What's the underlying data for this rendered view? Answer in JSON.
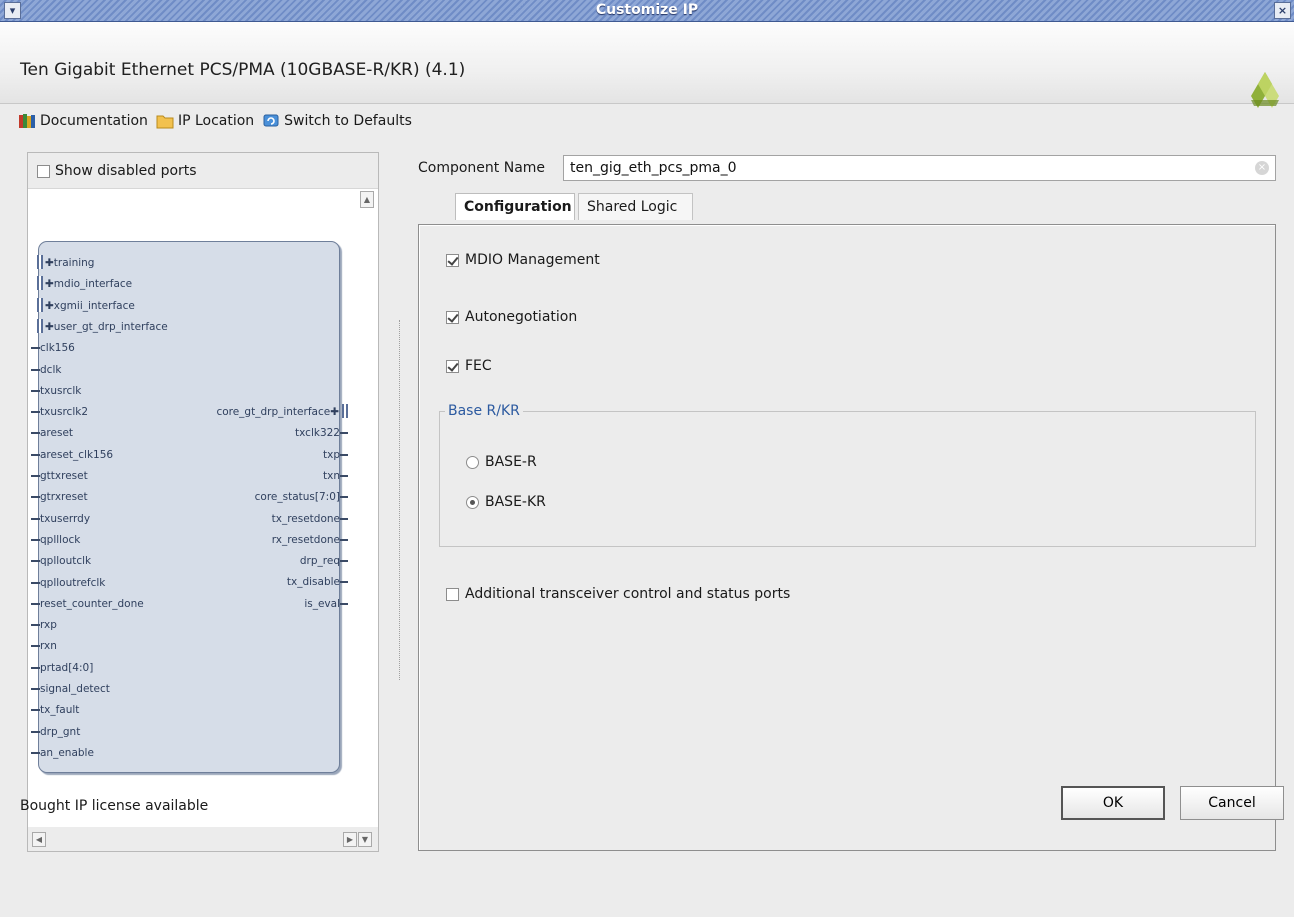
{
  "window": {
    "title": "Customize IP",
    "menu_glyph": "▾",
    "close_glyph": "×"
  },
  "header": {
    "ip_title": "Ten Gigabit Ethernet PCS/PMA (10GBASE-R/KR) (4.1)",
    "logo": "xilinx-logo"
  },
  "toolbar": {
    "documentation": "Documentation",
    "ip_location": "IP Location",
    "switch_defaults": "Switch to Defaults"
  },
  "left_panel": {
    "show_disabled_ports": "Show disabled ports",
    "left_ports": [
      {
        "name": "training",
        "bus": true
      },
      {
        "name": "mdio_interface",
        "bus": true
      },
      {
        "name": "xgmii_interface",
        "bus": true
      },
      {
        "name": "user_gt_drp_interface",
        "bus": true
      },
      {
        "name": "clk156",
        "bus": false
      },
      {
        "name": "dclk",
        "bus": false
      },
      {
        "name": "txusrclk",
        "bus": false
      },
      {
        "name": "txusrclk2",
        "bus": false
      },
      {
        "name": "areset",
        "bus": false
      },
      {
        "name": "areset_clk156",
        "bus": false
      },
      {
        "name": "gttxreset",
        "bus": false
      },
      {
        "name": "gtrxreset",
        "bus": false
      },
      {
        "name": "txuserrdy",
        "bus": false
      },
      {
        "name": "qplllock",
        "bus": false
      },
      {
        "name": "qplloutclk",
        "bus": false
      },
      {
        "name": "qplloutrefclk",
        "bus": false
      },
      {
        "name": "reset_counter_done",
        "bus": false
      },
      {
        "name": "rxp",
        "bus": false
      },
      {
        "name": "rxn",
        "bus": false
      },
      {
        "name": "prtad[4:0]",
        "bus": false
      },
      {
        "name": "signal_detect",
        "bus": false
      },
      {
        "name": "tx_fault",
        "bus": false
      },
      {
        "name": "drp_gnt",
        "bus": false
      },
      {
        "name": "an_enable",
        "bus": false
      }
    ],
    "right_ports": [
      {
        "name": "core_gt_drp_interface",
        "bus": true
      },
      {
        "name": "txclk322",
        "bus": false
      },
      {
        "name": "txp",
        "bus": false
      },
      {
        "name": "txn",
        "bus": false
      },
      {
        "name": "core_status[7:0]",
        "bus": false
      },
      {
        "name": "tx_resetdone",
        "bus": false
      },
      {
        "name": "rx_resetdone",
        "bus": false
      },
      {
        "name": "drp_req",
        "bus": false
      },
      {
        "name": "tx_disable",
        "bus": false
      },
      {
        "name": "is_eval",
        "bus": false
      }
    ]
  },
  "component": {
    "label": "Component Name",
    "value": "ten_gig_eth_pcs_pma_0"
  },
  "tabs": [
    {
      "label": "Configuration",
      "active": true
    },
    {
      "label": "Shared Logic",
      "active": false
    }
  ],
  "config": {
    "mdio_management": {
      "label": "MDIO Management",
      "checked": true
    },
    "autonegotiation": {
      "label": "Autonegotiation",
      "checked": true
    },
    "fec": {
      "label": "FEC",
      "checked": true
    },
    "base_group": {
      "legend": "Base R/KR",
      "options": [
        {
          "label": "BASE-R",
          "selected": false
        },
        {
          "label": "BASE-KR",
          "selected": true
        }
      ]
    },
    "additional_ports": {
      "label": "Additional transceiver control and status ports",
      "checked": false
    }
  },
  "footer": {
    "status": "Bought IP license available",
    "ok": "OK",
    "cancel": "Cancel"
  }
}
